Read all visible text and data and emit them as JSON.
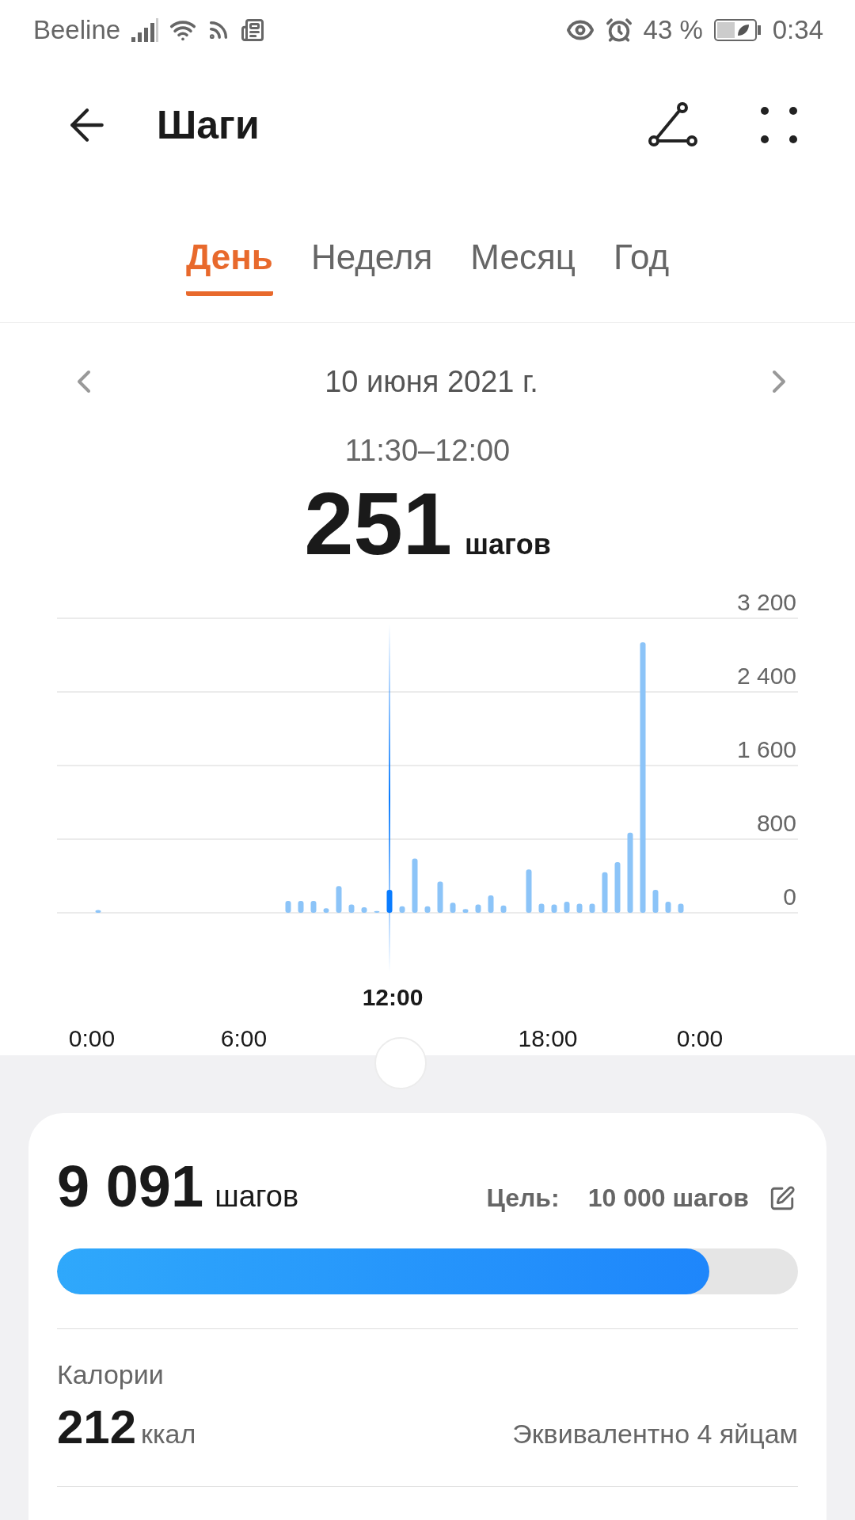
{
  "status_bar": {
    "carrier": "Beeline",
    "battery": "43 %",
    "time": "0:34"
  },
  "header": {
    "title": "Шаги"
  },
  "tabs": [
    {
      "label": "День",
      "selected": true
    },
    {
      "label": "Неделя",
      "selected": false
    },
    {
      "label": "Месяц",
      "selected": false
    },
    {
      "label": "Год",
      "selected": false
    }
  ],
  "date": "10 июня 2021 г.",
  "selection": {
    "range": "11:30–12:00",
    "value": "251",
    "unit": "шагов"
  },
  "chart_data": {
    "type": "bar",
    "grid": true,
    "x": [
      0.25,
      0.75,
      1.25,
      1.75,
      2.25,
      2.75,
      3.25,
      3.75,
      4.25,
      4.75,
      5.25,
      5.75,
      6.25,
      6.75,
      7.25,
      7.75,
      8.25,
      8.75,
      9.25,
      9.75,
      10.25,
      10.75,
      11.25,
      11.75,
      12.25,
      12.75,
      13.25,
      13.75,
      14.25,
      14.75,
      15.25,
      15.75,
      16.25,
      16.75,
      17.25,
      17.75,
      18.25,
      18.75,
      19.25,
      19.75,
      20.25,
      20.75,
      21.25,
      21.75,
      22.25,
      22.75,
      23.25,
      23.75
    ],
    "values": [
      30,
      0,
      0,
      0,
      0,
      0,
      0,
      0,
      0,
      0,
      0,
      0,
      0,
      0,
      0,
      130,
      130,
      130,
      50,
      290,
      90,
      60,
      20,
      250,
      70,
      590,
      70,
      340,
      110,
      40,
      90,
      190,
      80,
      0,
      470,
      100,
      90,
      120,
      100,
      100,
      440,
      550,
      870,
      2940,
      250,
      120,
      100,
      0
    ],
    "xlim": [
      0,
      24
    ],
    "xticks": [
      {
        "value": 0,
        "label": "0:00"
      },
      {
        "value": 6,
        "label": "6:00"
      },
      {
        "value": 18,
        "label": "18:00"
      },
      {
        "value": 24,
        "label": "0:00"
      }
    ],
    "ylim": [
      0,
      3200
    ],
    "yticks": [
      {
        "value": 0,
        "label": "0"
      },
      {
        "value": 800,
        "label": "800"
      },
      {
        "value": 1600,
        "label": "1 600"
      },
      {
        "value": 2400,
        "label": "2 400"
      },
      {
        "value": 3200,
        "label": "3 200"
      }
    ],
    "ref_lines": [
      {
        "axis": "x",
        "value": 11.75
      }
    ],
    "annotations": [
      "12:00"
    ]
  },
  "summary": {
    "steps": "9 091",
    "unit": "шагов",
    "goal_label": "Цель:",
    "goal_value": "10 000 шагов",
    "level": 0.88
  },
  "calories": {
    "label": "Калории",
    "value": "212",
    "unit": "ккал",
    "equivalent": "Эквивалентно 4 яйцам"
  }
}
